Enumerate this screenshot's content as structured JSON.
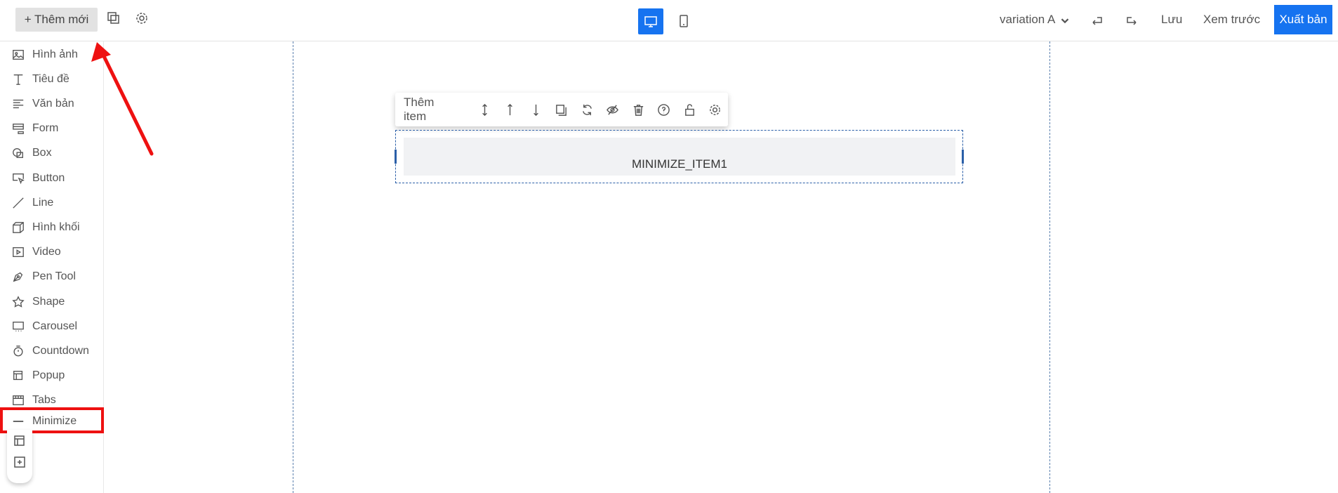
{
  "header": {
    "add_label": "+ Thêm mới",
    "variation": "variation A",
    "save": "Lưu",
    "preview": "Xem trước",
    "publish": "Xuất bản"
  },
  "sidebar": {
    "items": [
      {
        "label": "Hình ảnh",
        "icon": "image-icon"
      },
      {
        "label": "Tiêu đề",
        "icon": "title-icon"
      },
      {
        "label": "Văn bản",
        "icon": "text-icon"
      },
      {
        "label": "Form",
        "icon": "form-icon"
      },
      {
        "label": "Box",
        "icon": "box-icon"
      },
      {
        "label": "Button",
        "icon": "button-icon"
      },
      {
        "label": "Line",
        "icon": "line-icon"
      },
      {
        "label": "Hình khối",
        "icon": "cube-icon"
      },
      {
        "label": "Video",
        "icon": "video-icon"
      },
      {
        "label": "Pen Tool",
        "icon": "pen-icon"
      },
      {
        "label": "Shape",
        "icon": "star-icon"
      },
      {
        "label": "Carousel",
        "icon": "carousel-icon"
      },
      {
        "label": "Countdown",
        "icon": "timer-icon"
      },
      {
        "label": "Popup",
        "icon": "popup-icon"
      },
      {
        "label": "Tabs",
        "icon": "tabs-icon"
      },
      {
        "label": "Minimize",
        "icon": "minimize-icon"
      }
    ]
  },
  "toolbar": {
    "add_item": "Thêm item"
  },
  "canvas": {
    "element_label": "MINIMIZE_ITEM1"
  },
  "colors": {
    "accent": "#1673f0",
    "highlight": "#ee1111"
  }
}
